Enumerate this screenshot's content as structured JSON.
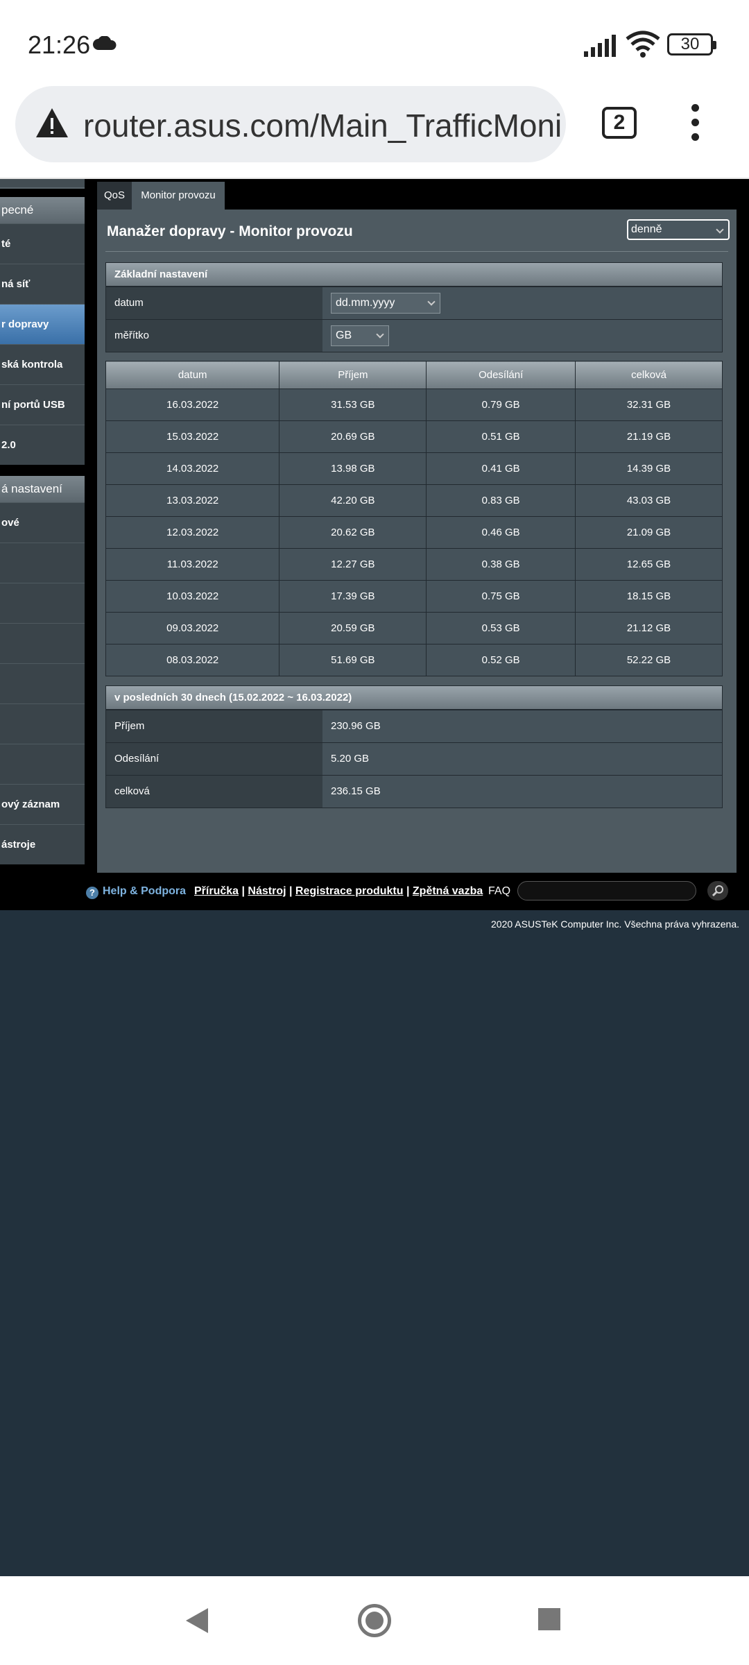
{
  "status_bar": {
    "time": "21:26",
    "battery": "30"
  },
  "browser": {
    "url": "router.asus.com/Main_TrafficMoni",
    "tab_count": "2"
  },
  "sidebar": {
    "group1_title": "pecné",
    "items": [
      "té",
      "ná síť",
      "r dopravy",
      "ská kontrola",
      "ní portů USB",
      "2.0"
    ],
    "active_index": 2,
    "group2_title": "á nastavení",
    "items2": [
      "ové",
      "",
      "",
      "",
      "",
      "",
      "",
      "ový záznam",
      "ástroje"
    ]
  },
  "tabs": {
    "qos": "QoS",
    "monitor": "Monitor provozu"
  },
  "main": {
    "title": "Manažer dopravy - Monitor provozu",
    "period_select": "denně",
    "basic_settings": {
      "header": "Základní nastavení",
      "date_label": "datum",
      "date_value": "dd.mm.yyyy",
      "scale_label": "měřítko",
      "scale_value": "GB"
    },
    "table": {
      "headers": [
        "datum",
        "Příjem",
        "Odesílání",
        "celková"
      ],
      "rows": [
        [
          "16.03.2022",
          "31.53 GB",
          "0.79 GB",
          "32.31 GB"
        ],
        [
          "15.03.2022",
          "20.69 GB",
          "0.51 GB",
          "21.19 GB"
        ],
        [
          "14.03.2022",
          "13.98 GB",
          "0.41 GB",
          "14.39 GB"
        ],
        [
          "13.03.2022",
          "42.20 GB",
          "0.83 GB",
          "43.03 GB"
        ],
        [
          "12.03.2022",
          "20.62 GB",
          "0.46 GB",
          "21.09 GB"
        ],
        [
          "11.03.2022",
          "12.27 GB",
          "0.38 GB",
          "12.65 GB"
        ],
        [
          "10.03.2022",
          "17.39 GB",
          "0.75 GB",
          "18.15 GB"
        ],
        [
          "09.03.2022",
          "20.59 GB",
          "0.53 GB",
          "21.12 GB"
        ],
        [
          "08.03.2022",
          "51.69 GB",
          "0.52 GB",
          "52.22 GB"
        ]
      ]
    },
    "summary": {
      "header": "v posledních 30 dnech (15.02.2022 ~ 16.03.2022)",
      "rx_label": "Příjem",
      "rx_value": "230.96 GB",
      "tx_label": "Odesílání",
      "tx_value": "5.20 GB",
      "total_label": "celková",
      "total_value": "236.15 GB"
    }
  },
  "footer": {
    "help": "Help & Podpora",
    "links": [
      "Příručka",
      "Nástroj",
      "Registrace produktu",
      "Zpětná vazba"
    ],
    "faq": "FAQ",
    "copyright": "2020 ASUSTeK Computer Inc. Všechna práva vyhrazena."
  }
}
